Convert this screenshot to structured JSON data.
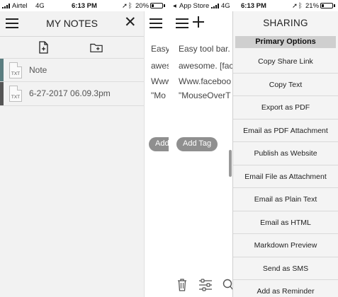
{
  "left_phone": {
    "status": {
      "carrier": "Airtel",
      "network": "4G",
      "time": "6:13 PM",
      "battery": "20%",
      "battery_level": 0.2
    },
    "drawer": {
      "title": "MY NOTES",
      "toolbar": [
        {
          "icon": "new-note-icon"
        },
        {
          "icon": "new-folder-icon"
        }
      ],
      "notes": [
        {
          "type": "TXT",
          "label": "Note",
          "marker_color": "#5a7d80"
        },
        {
          "type": "TXT",
          "label": "6-27-2017 06.09.3pm",
          "marker_color": "#555555"
        }
      ]
    },
    "editor_peek": {
      "lines": [
        "Easy",
        "awes",
        "Www",
        "\"Mo"
      ],
      "tag_button": "Add"
    }
  },
  "right_phone": {
    "status": {
      "back_label": "App Store",
      "network": "4G",
      "time": "6:13 PM",
      "battery": "21%",
      "battery_level": 0.21
    },
    "editor": {
      "lines": [
        "Easy tool bar. T",
        "awesome. [fac",
        "Www.faceboo",
        "\"MouseOverT"
      ],
      "tag_button": "Add Tag",
      "bottom_icons": [
        "trash-icon",
        "sliders-icon",
        "search-icon"
      ]
    },
    "sharing": {
      "title": "SHARING",
      "section": "Primary Options",
      "options": [
        "Copy Share Link",
        "Copy Text",
        "Export as PDF",
        "Email as PDF Attachment",
        "Publish as Website",
        "Email File as Attachment",
        "Email as Plain Text",
        "Email as HTML",
        "Markdown Preview",
        "Send as SMS",
        "Add as Reminder"
      ]
    }
  },
  "colors": {
    "drawer_bg": "#f2f2f2",
    "section_bg": "#cfcfcf",
    "tag_button_bg": "#8f8f8f"
  }
}
